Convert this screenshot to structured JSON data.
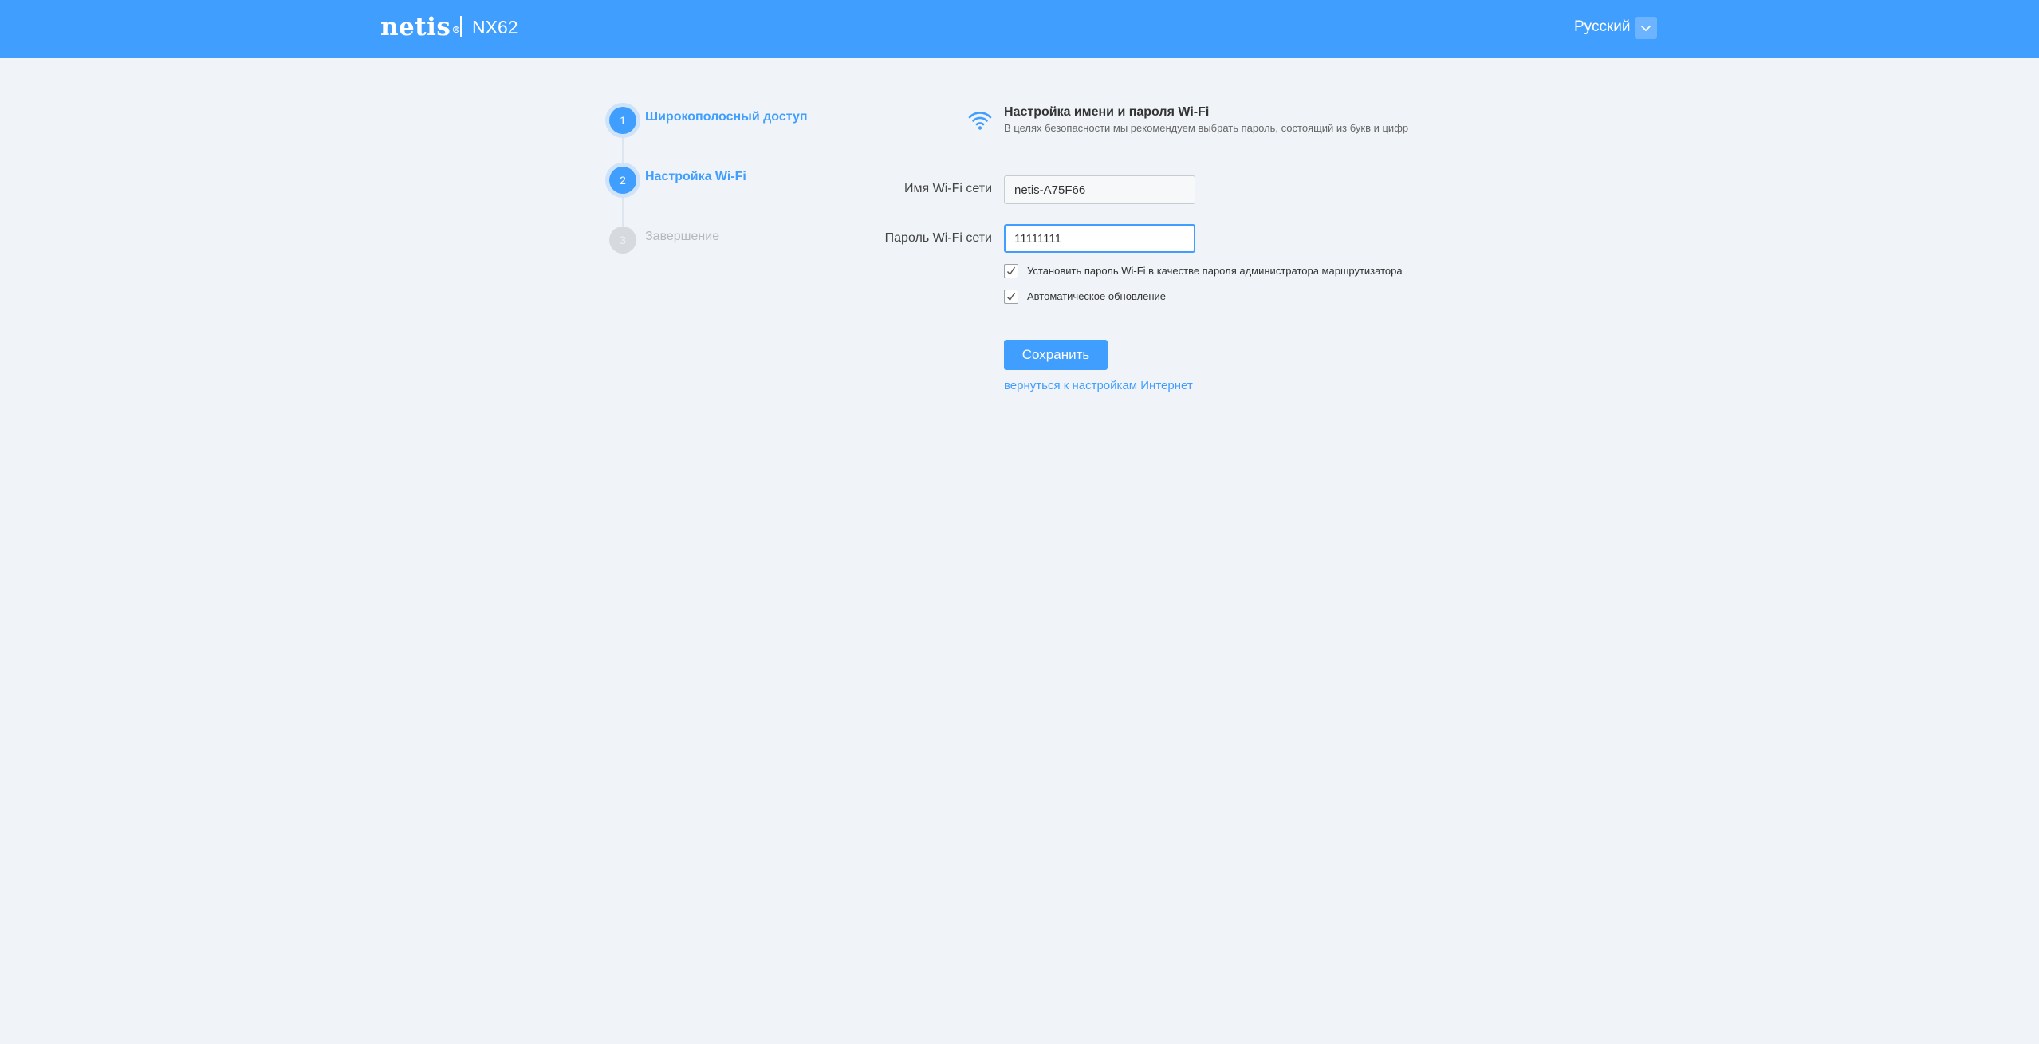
{
  "header": {
    "brand": "netis",
    "brand_mark": "®",
    "model": "NX62",
    "language": "Русский",
    "lang_dropdown_icon": "chevron-down-icon",
    "color": "#409eff"
  },
  "steps": [
    {
      "number": "1",
      "label": "Широкополосный доступ",
      "state": "done"
    },
    {
      "number": "2",
      "label": "Настройка Wi-Fi",
      "state": "active"
    },
    {
      "number": "3",
      "label": "Завершение",
      "state": "pending"
    }
  ],
  "section": {
    "icon": "wifi-icon",
    "title": "Настройка имени и пароля Wi-Fi",
    "subtitle": "В целях безопасности мы рекомендуем выбрать пароль, состоящий из букв и цифр"
  },
  "form": {
    "ssid_label": "Имя Wi-Fi сети",
    "ssid_value": "netis-A75F66",
    "password_label": "Пароль Wi-Fi сети",
    "password_value": "11111111",
    "checkbox_admin_label": "Установить пароль Wi-Fi в качестве пароля администратора маршрутизатора",
    "checkbox_admin_checked": true,
    "checkbox_update_label": "Автоматическое обновление",
    "checkbox_update_checked": true,
    "save_label": "Сохранить",
    "back_link": "вернуться к настройкам Интернет"
  }
}
